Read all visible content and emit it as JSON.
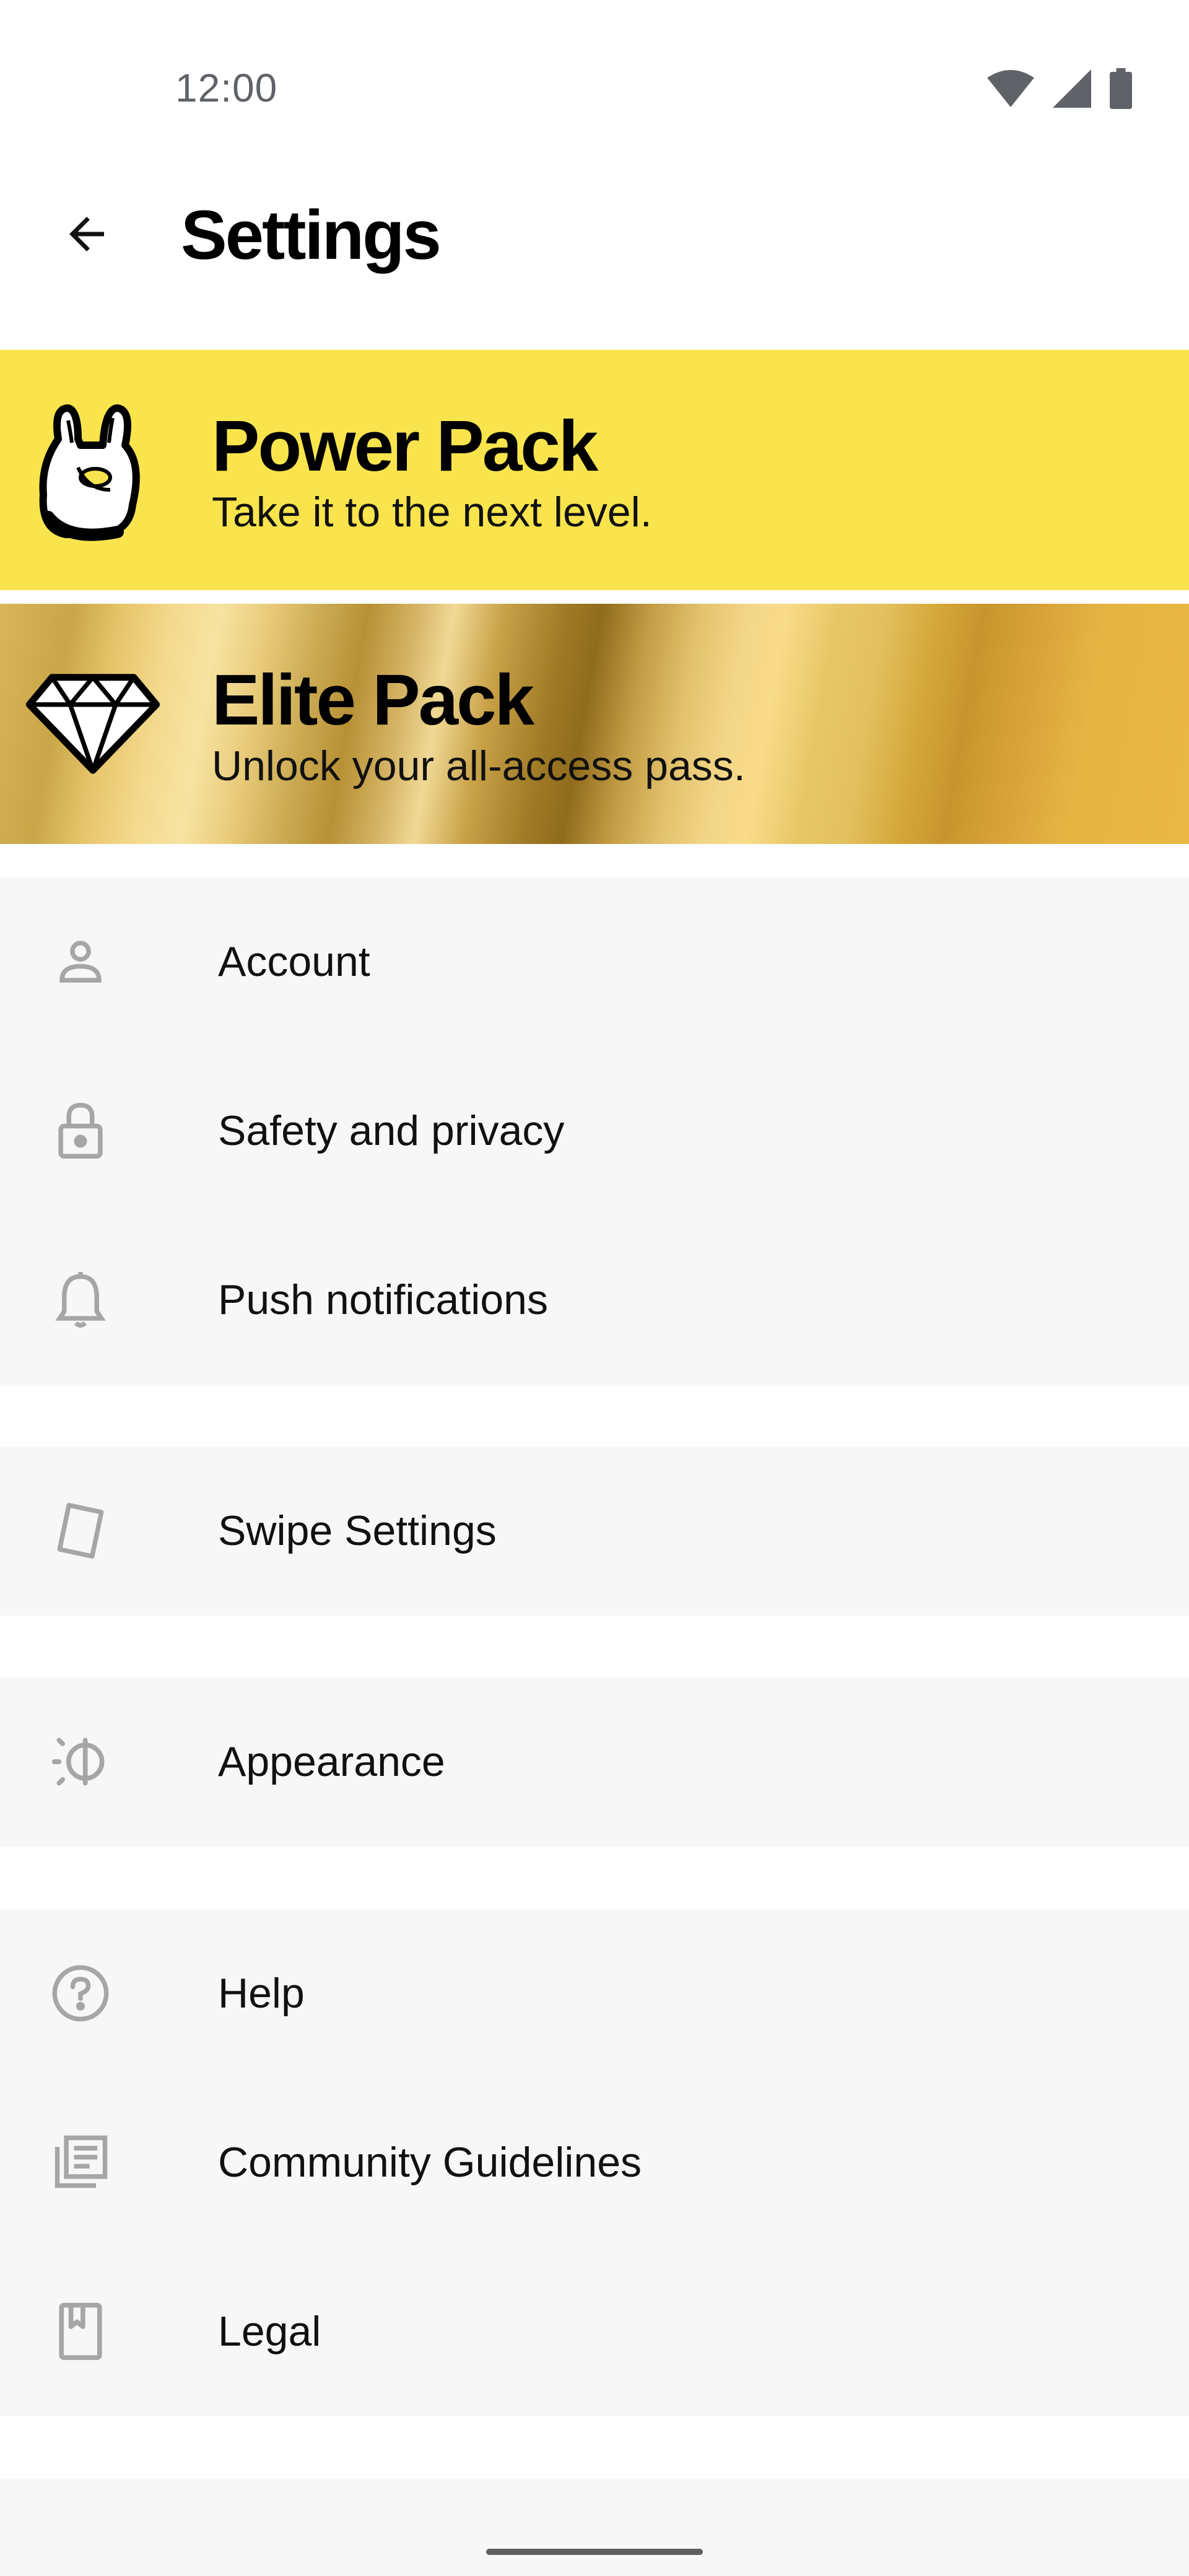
{
  "status_bar": {
    "time": "12:00",
    "icons": [
      "wifi-icon",
      "cellular-signal-icon",
      "battery-icon"
    ]
  },
  "app_bar": {
    "back_icon": "arrow-back-icon",
    "title": "Settings"
  },
  "banners": [
    {
      "id": "power",
      "icon": "rock-hand-icon",
      "title": "Power Pack",
      "subtitle": "Take it to the next level.",
      "color": "#f9e44d"
    },
    {
      "id": "elite",
      "icon": "diamond-icon",
      "title": "Elite Pack",
      "subtitle": "Unlock your all-access pass.",
      "color": "#d9b659"
    }
  ],
  "groups": [
    {
      "items": [
        {
          "label": "Account",
          "icon": "person-icon"
        },
        {
          "label": "Safety and privacy",
          "icon": "lock-icon"
        },
        {
          "label": "Push notifications",
          "icon": "bell-icon"
        }
      ]
    },
    {
      "items": [
        {
          "label": "Swipe Settings",
          "icon": "card-icon"
        }
      ]
    },
    {
      "items": [
        {
          "label": "Appearance",
          "icon": "brightness-icon"
        }
      ]
    },
    {
      "items": [
        {
          "label": "Help",
          "icon": "help-circle-icon"
        },
        {
          "label": "Community Guidelines",
          "icon": "guidelines-icon"
        },
        {
          "label": "Legal",
          "icon": "book-icon"
        }
      ]
    }
  ],
  "colors": {
    "background": "#ffffff",
    "group_background": "#f7f7f7",
    "icon_gray": "#a6a6a6",
    "power_yellow": "#f9e44d"
  }
}
